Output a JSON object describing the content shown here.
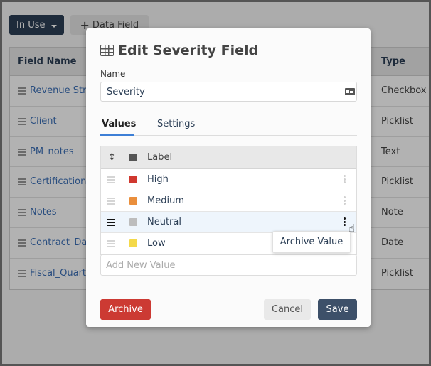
{
  "background": {
    "toolbar": {
      "filter_label": "In Use",
      "add_button_label": "Data Field"
    },
    "table": {
      "headers": {
        "field_name": "Field Name",
        "type": "Type"
      },
      "rows": [
        {
          "name": "Revenue Strea",
          "type": "Checkbox"
        },
        {
          "name": "Client",
          "type": "Picklist"
        },
        {
          "name": "PM_notes",
          "type": "Text"
        },
        {
          "name": "Certification",
          "type": "Picklist"
        },
        {
          "name": "Notes",
          "type": "Note"
        },
        {
          "name": "Contract_Date",
          "type": "Date"
        },
        {
          "name": "Fiscal_Quarte",
          "type": "Picklist"
        }
      ]
    }
  },
  "modal": {
    "title": "Edit Severity Field",
    "title_icon": "table-grid-icon",
    "name_label": "Name",
    "name_value": "Severity",
    "name_icon": "id-card-icon",
    "tabs": [
      {
        "label": "Values",
        "active": true
      },
      {
        "label": "Settings",
        "active": false
      }
    ],
    "values_table": {
      "header": {
        "sort_icon": "↕",
        "label": "Label",
        "swatch_color": "#555555"
      },
      "rows": [
        {
          "label": "High",
          "color": "#d0382f",
          "active": false
        },
        {
          "label": "Medium",
          "color": "#ea8f3c",
          "active": false
        },
        {
          "label": "Neutral",
          "color": "#bdbdbd",
          "active": true
        },
        {
          "label": "Low",
          "color": "#f4d94a",
          "active": false
        }
      ]
    },
    "add_value_placeholder": "Add New Value",
    "context_menu": {
      "items": [
        "Archive Value"
      ]
    },
    "buttons": {
      "archive": "Archive",
      "cancel": "Cancel",
      "save": "Save"
    }
  },
  "colors": {
    "primary": "#2b3e55",
    "danger": "#cc3a33",
    "link": "#3b6fb6",
    "tab_accent": "#3d7fd6"
  }
}
